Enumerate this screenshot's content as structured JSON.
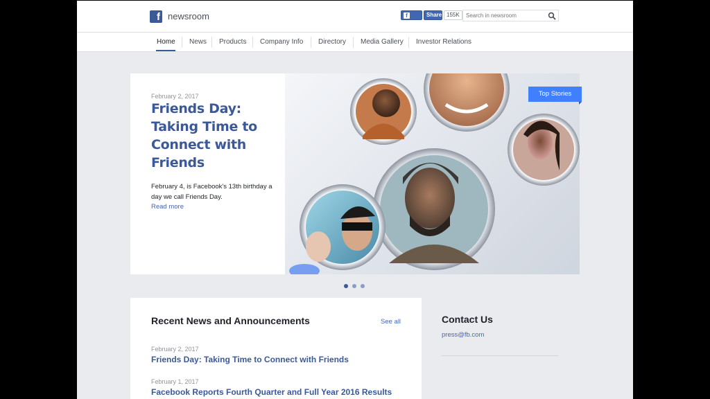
{
  "header": {
    "brand": "newsroom",
    "logo_letter": "f",
    "like_label": "Like",
    "share_label": "Share",
    "share_count": "155K",
    "search_placeholder": "Search in newsroom"
  },
  "nav": {
    "items": [
      {
        "label": "Home",
        "active": true
      },
      {
        "label": "News"
      },
      {
        "label": "Products"
      },
      {
        "label": "Company Info"
      },
      {
        "label": "Directory"
      },
      {
        "label": "Media Gallery"
      },
      {
        "label": "Investor Relations"
      }
    ]
  },
  "hero": {
    "date": "February 2, 2017",
    "title": "Friends Day: Taking Time to Connect with Friends",
    "summary": "February 4, is Facebook's 13th birthday a day we call Friends Day.",
    "read_more": "Read more",
    "badge": "Top Stories",
    "carousel_slides": 3,
    "carousel_active": 1
  },
  "news": {
    "heading": "Recent News and Announcements",
    "see_all": "See all",
    "items": [
      {
        "date": "February 2, 2017",
        "title": "Friends Day: Taking Time to Connect with Friends"
      },
      {
        "date": "February 1, 2017",
        "title": "Facebook Reports Fourth Quarter and Full Year 2016 Results"
      }
    ]
  },
  "contact": {
    "heading": "Contact Us",
    "email": "press@fb.com"
  },
  "colors": {
    "brand": "#3b5998",
    "accent": "#4080ff",
    "link": "#4267b2",
    "page_bg": "#e9ebee"
  }
}
